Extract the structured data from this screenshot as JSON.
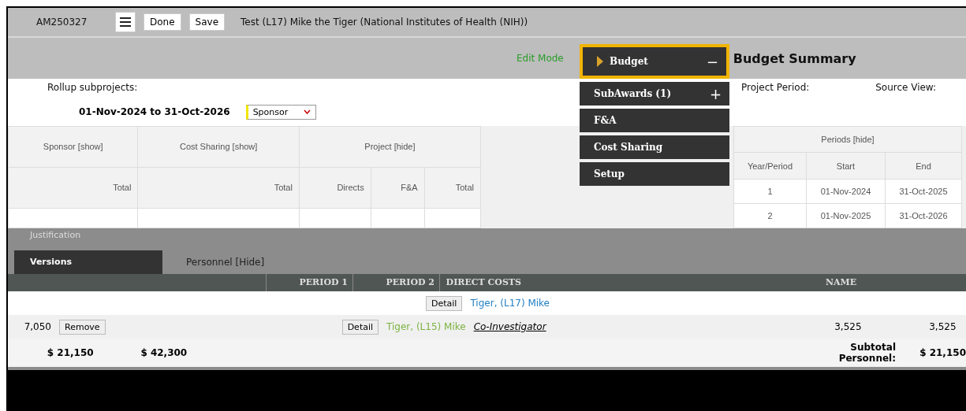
{
  "header": {
    "record_id": "AM250327",
    "buttons": [
      "Done",
      "Save"
    ],
    "title": "Test (L17) Mike the Tiger (National Institutes of Health (NIH))"
  },
  "mode": "Edit Mode",
  "menu": [
    {
      "label": "Budget",
      "selected": true,
      "toggle": "−"
    },
    {
      "label": "SubAwards (1)",
      "selected": false,
      "toggle": "+"
    },
    {
      "label": "F&A",
      "selected": false
    },
    {
      "label": "Cost Sharing",
      "selected": false
    },
    {
      "label": "Setup",
      "selected": false
    }
  ],
  "summary": {
    "heading": "Budget Summary",
    "rollup_label": "Rollup subprojects:",
    "project_period_label": "Project Period:",
    "source_view_label": "Source View:",
    "period": "01-Nov-2024 to 31-Oct-2026",
    "view_select": "Sponsor"
  },
  "project_table": {
    "groups": [
      {
        "label": "Sponsor [show]"
      },
      {
        "label": "Cost Sharing [show]"
      },
      {
        "label": "Project [hide]"
      }
    ],
    "columns": [
      "Total",
      "Total",
      "Directs",
      "F&A",
      "Total"
    ]
  },
  "periods_table": {
    "group": "Periods [hide]",
    "columns": [
      "Year/Period",
      "Start",
      "End"
    ],
    "rows": [
      [
        "1",
        "01-Nov-2024",
        "31-Oct-2025"
      ],
      [
        "2",
        "01-Nov-2025",
        "31-Oct-2026"
      ]
    ]
  },
  "personnel": {
    "justification": "Justification",
    "versions": "Versions",
    "title": "Personnel [Hide]",
    "columns": [
      "PERIOD 1",
      "PERIOD 2",
      "DIRECT COSTS",
      "NAME"
    ],
    "rows": [
      {
        "kind": "link",
        "detail": "Detail",
        "name": "Tiger, (L17) Mike"
      },
      {
        "kind": "member",
        "amount": "7,050",
        "remove": "Remove",
        "detail": "Detail",
        "name": "Tiger, (L15) Mike",
        "role": "Co-Investigator",
        "period_1": "3,525",
        "period_2": "3,525"
      }
    ],
    "totals": {
      "period_1": "$ 21,150",
      "period_2": "$ 42,300",
      "label": "Subtotal Personnel:",
      "total": "$ 21,150"
    }
  }
}
